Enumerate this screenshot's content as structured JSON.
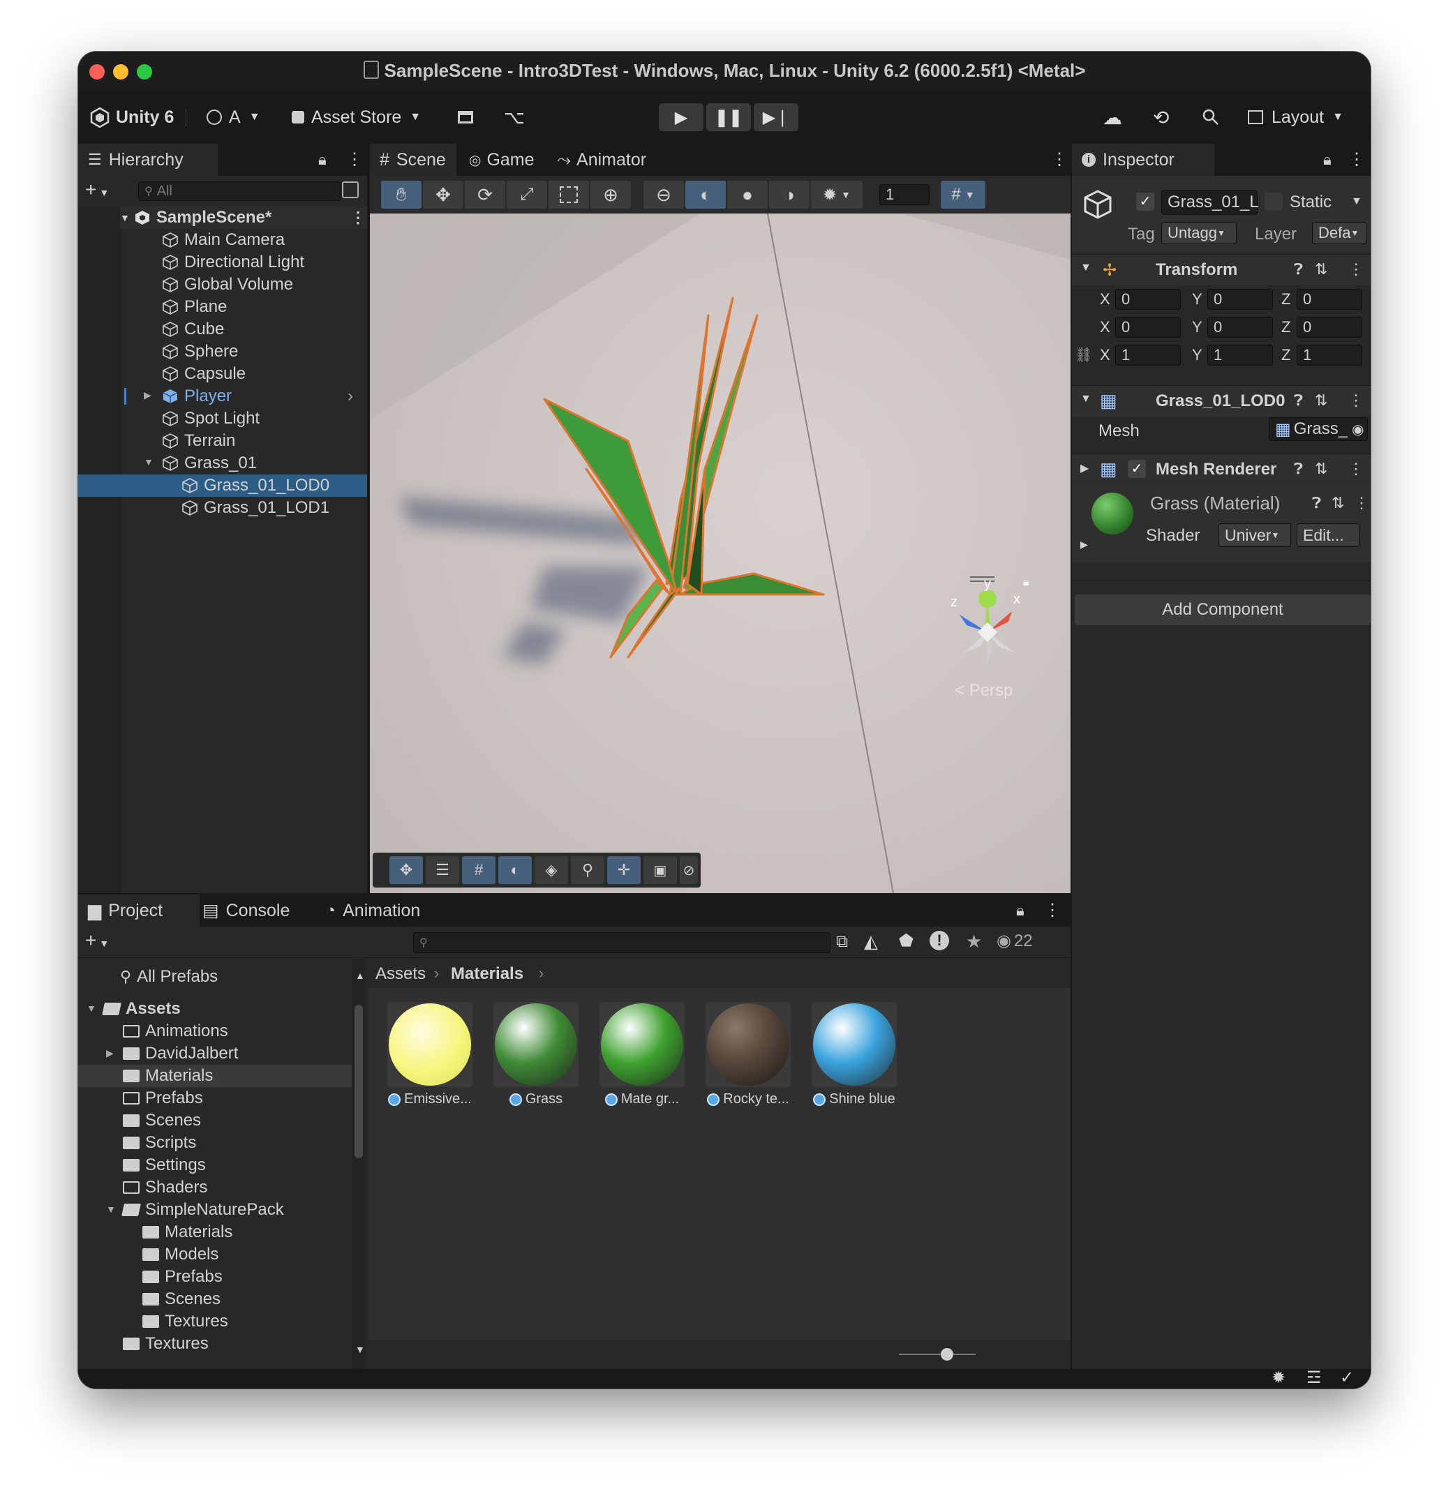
{
  "window": {
    "title": "SampleScene - Intro3DTest - Windows, Mac, Linux - Unity 6.2 (6000.2.5f1) <Metal>"
  },
  "toolbar": {
    "account_label": "Unity 6",
    "user_initial": "A",
    "asset_store_label": "Asset Store",
    "layout_label": "Layout"
  },
  "hierarchy": {
    "tab_label": "Hierarchy",
    "search_placeholder": "All",
    "scene_name": "SampleScene*",
    "items": [
      {
        "label": "Main Camera"
      },
      {
        "label": "Directional Light"
      },
      {
        "label": "Global Volume"
      },
      {
        "label": "Plane"
      },
      {
        "label": "Cube"
      },
      {
        "label": "Sphere"
      },
      {
        "label": "Capsule"
      },
      {
        "label": "Player"
      },
      {
        "label": "Spot Light"
      },
      {
        "label": "Terrain"
      },
      {
        "label": "Grass_01"
      },
      {
        "label": "Grass_01_LOD0"
      },
      {
        "label": "Grass_01_LOD1"
      }
    ]
  },
  "scene_view": {
    "tabs": [
      "Scene",
      "Game",
      "Animator"
    ],
    "grid_value": "1",
    "gizmo_label": "Persp",
    "gizmo_axes": {
      "x": "x",
      "y": "y",
      "z": "z"
    }
  },
  "inspector": {
    "tab_label": "Inspector",
    "object_name": "Grass_01_L",
    "static_label": "Static",
    "tag_label": "Tag",
    "tag_value": "Untagg",
    "layer_label": "Layer",
    "layer_value": "Defa",
    "transform": {
      "title": "Transform",
      "position": {
        "x": "0",
        "y": "0",
        "z": "0"
      },
      "rotation": {
        "x": "0",
        "y": "0",
        "z": "0"
      },
      "scale": {
        "x": "1",
        "y": "1",
        "z": "1"
      },
      "axis_x": "X",
      "axis_y": "Y",
      "axis_z": "Z"
    },
    "mesh_filter": {
      "title": "Grass_01_LOD0",
      "mesh_label": "Mesh",
      "mesh_value": "Grass_"
    },
    "mesh_renderer": {
      "title": "Mesh Renderer"
    },
    "material": {
      "name": "Grass (Material)",
      "shader_label": "Shader",
      "shader_value": "Univer",
      "edit_label": "Edit..."
    },
    "add_component_label": "Add Component"
  },
  "project": {
    "tabs": [
      "Project",
      "Console",
      "Animation"
    ],
    "hidden_count": "22",
    "favorites": "All Prefabs",
    "breadcrumb": [
      "Assets",
      "Materials"
    ],
    "tree": [
      {
        "label": "Assets",
        "level": 0
      },
      {
        "label": "Animations",
        "level": 1
      },
      {
        "label": "DavidJalbert",
        "level": 1
      },
      {
        "label": "Materials",
        "level": 1
      },
      {
        "label": "Prefabs",
        "level": 1
      },
      {
        "label": "Scenes",
        "level": 1
      },
      {
        "label": "Scripts",
        "level": 1
      },
      {
        "label": "Settings",
        "level": 1
      },
      {
        "label": "Shaders",
        "level": 1
      },
      {
        "label": "SimpleNaturePack",
        "level": 1
      },
      {
        "label": "Materials",
        "level": 2
      },
      {
        "label": "Models",
        "level": 2
      },
      {
        "label": "Prefabs",
        "level": 2
      },
      {
        "label": "Scenes",
        "level": 2
      },
      {
        "label": "Textures",
        "level": 2
      },
      {
        "label": "Textures",
        "level": 1
      }
    ],
    "assets": [
      {
        "label": "Emissive...",
        "color": "#f6f57a"
      },
      {
        "label": "Grass",
        "color": "#3f8a35"
      },
      {
        "label": "Mate gr...",
        "color": "#3ea22f"
      },
      {
        "label": "Rocky te...",
        "color": "#5a4a3e"
      },
      {
        "label": "Shine blue",
        "color": "#3aa3dd"
      }
    ]
  },
  "colors": {
    "selection": "#2c5d87",
    "accent_blue": "#46607c",
    "player_text": "#7fb0ea"
  }
}
